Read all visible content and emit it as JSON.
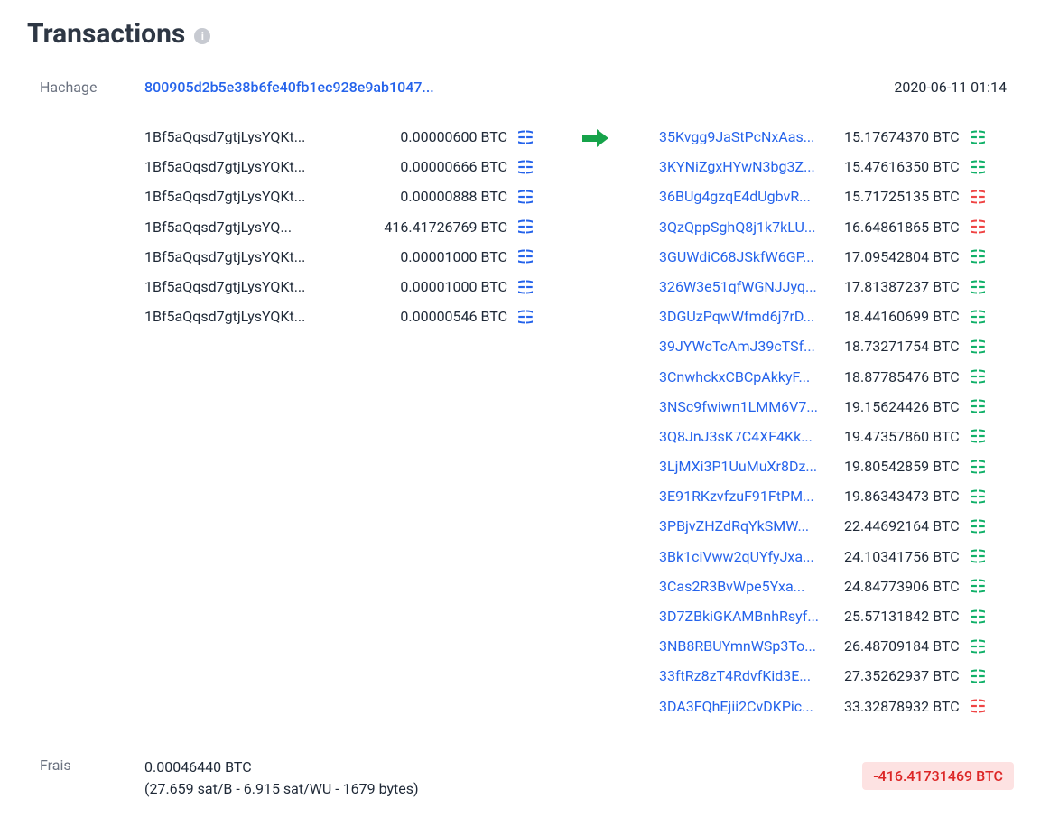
{
  "title": "Transactions",
  "labels": {
    "hash": "Hachage",
    "fee": "Frais"
  },
  "hash": "800905d2b5e38b6fe40fb1ec928e9ab1047...",
  "timestamp": "2020-06-11 01:14",
  "inputs": [
    {
      "addr": "1Bf5aQqsd7gtjLysYQKt...",
      "amount": "0.00000600 BTC",
      "globe": "blue"
    },
    {
      "addr": "1Bf5aQqsd7gtjLysYQKt...",
      "amount": "0.00000666 BTC",
      "globe": "blue"
    },
    {
      "addr": "1Bf5aQqsd7gtjLysYQKt...",
      "amount": "0.00000888 BTC",
      "globe": "blue"
    },
    {
      "addr": "1Bf5aQqsd7gtjLysYQ...",
      "amount": "416.41726769 BTC",
      "globe": "blue"
    },
    {
      "addr": "1Bf5aQqsd7gtjLysYQKt...",
      "amount": "0.00001000 BTC",
      "globe": "blue"
    },
    {
      "addr": "1Bf5aQqsd7gtjLysYQKt...",
      "amount": "0.00001000 BTC",
      "globe": "blue"
    },
    {
      "addr": "1Bf5aQqsd7gtjLysYQKt...",
      "amount": "0.00000546 BTC",
      "globe": "blue"
    }
  ],
  "outputs": [
    {
      "addr": "35Kvgg9JaStPcNxAas...",
      "amount": "15.17674370 BTC",
      "globe": "green"
    },
    {
      "addr": "3KYNiZgxHYwN3bg3Z...",
      "amount": "15.47616350 BTC",
      "globe": "green"
    },
    {
      "addr": "36BUg4gzqE4dUgbvR...",
      "amount": "15.71725135 BTC",
      "globe": "red"
    },
    {
      "addr": "3QzQppSghQ8j1k7kLU...",
      "amount": "16.64861865 BTC",
      "globe": "red"
    },
    {
      "addr": "3GUWdiC68JSkfW6GP...",
      "amount": "17.09542804 BTC",
      "globe": "green"
    },
    {
      "addr": "326W3e51qfWGNJJyq...",
      "amount": "17.81387237 BTC",
      "globe": "green"
    },
    {
      "addr": "3DGUzPqwWfmd6j7rD...",
      "amount": "18.44160699 BTC",
      "globe": "green"
    },
    {
      "addr": "39JYWcTcAmJ39cTSf...",
      "amount": "18.73271754 BTC",
      "globe": "green"
    },
    {
      "addr": "3CnwhckxCBCpAkkyF...",
      "amount": "18.87785476 BTC",
      "globe": "green"
    },
    {
      "addr": "3NSc9fwiwn1LMM6V7...",
      "amount": "19.15624426 BTC",
      "globe": "green"
    },
    {
      "addr": "3Q8JnJ3sK7C4XF4Kk...",
      "amount": "19.47357860 BTC",
      "globe": "green"
    },
    {
      "addr": "3LjMXi3P1UuMuXr8Dz...",
      "amount": "19.80542859 BTC",
      "globe": "green"
    },
    {
      "addr": "3E91RKzvfzuF91FtPM...",
      "amount": "19.86343473 BTC",
      "globe": "green"
    },
    {
      "addr": "3PBjvZHZdRqYkSMW...",
      "amount": "22.44692164 BTC",
      "globe": "green"
    },
    {
      "addr": "3Bk1ciVww2qUYfyJxa...",
      "amount": "24.10341756 BTC",
      "globe": "green"
    },
    {
      "addr": "3Cas2R3BvWpe5Yxa...",
      "amount": "24.84773906 BTC",
      "globe": "green"
    },
    {
      "addr": "3D7ZBkiGKAMBnhRsyf...",
      "amount": "25.57131842 BTC",
      "globe": "green"
    },
    {
      "addr": "3NB8RBUYmnWSp3To...",
      "amount": "26.48709184 BTC",
      "globe": "green"
    },
    {
      "addr": "33ftRz8zT4RdvfKid3E...",
      "amount": "27.35262937 BTC",
      "globe": "green"
    },
    {
      "addr": "3DA3FQhEjii2CvDKPic...",
      "amount": "33.32878932 BTC",
      "globe": "red"
    }
  ],
  "fee": {
    "amount": "0.00046440 BTC",
    "detail": "(27.659 sat/B - 6.915 sat/WU - 1679 bytes)"
  },
  "net": "-416.41731469 BTC",
  "colors": {
    "blue": "#2563eb",
    "green": "#10b068",
    "red": "#ef4444"
  }
}
